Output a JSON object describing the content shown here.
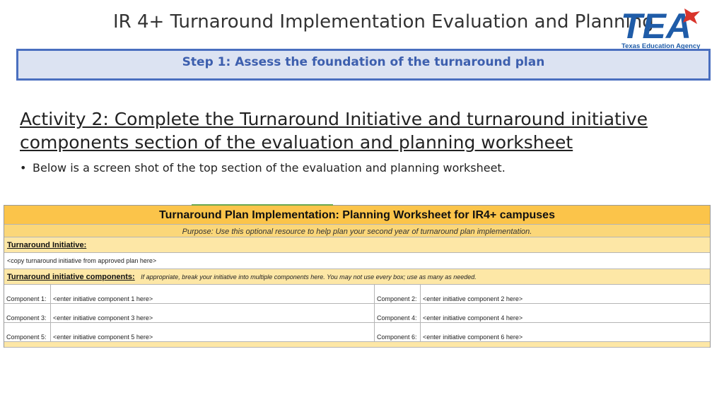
{
  "slide": {
    "title": "IR 4+ Turnaround Implementation Evaluation and  Planning",
    "logo": {
      "mark": "TEA",
      "caption": "Texas Education Agency",
      "colors": {
        "blue": "#1f5ca8",
        "red": "#d9342b"
      }
    }
  },
  "step_banner": {
    "text": "Step 1: Assess the foundation of the turnaround plan"
  },
  "activity": {
    "heading": "Activity 2: Complete the Turnaround Initiative and turnaround initiative components section of the evaluation and planning worksheet",
    "bullet": "Below is a screen shot of the top section of the evaluation and planning worksheet."
  },
  "worksheet": {
    "title": "Turnaround Plan Implementation: Planning Worksheet for IR4+ campuses",
    "purpose": "Purpose: Use this optional resource to help plan your second year of turnaround plan implementation.",
    "initiative_label": "Turnaround Initiative:",
    "initiative_value": "<copy turnaround initiative from approved plan here>",
    "components_label": "Turnaround initiative components:",
    "components_hint": "If appropriate, break your initiative into multiple components here. You may not use every box; use as many  as needed.",
    "components": [
      {
        "label": "Component 1:",
        "value": "<enter initiative component 1 here>"
      },
      {
        "label": "Component 2:",
        "value": "<enter initiative component 2 here>"
      },
      {
        "label": "Component 3:",
        "value": "<enter initiative component 3 here>"
      },
      {
        "label": "Component 4:",
        "value": "<enter initiative component 4 here>"
      },
      {
        "label": "Component 5:",
        "value": "<enter initiative component 5 here>"
      },
      {
        "label": "Component 6:",
        "value": "<enter initiative component 6 here>"
      }
    ],
    "colors": {
      "header": "#fbc44a",
      "purpose": "#fbd779",
      "section": "#fde7a6"
    }
  }
}
